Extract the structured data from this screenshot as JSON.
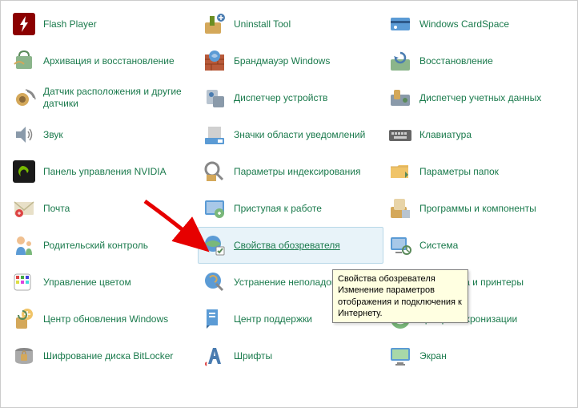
{
  "items": [
    {
      "label": "Flash Player",
      "icon": "flash"
    },
    {
      "label": "Uninstall Tool",
      "icon": "uninstall"
    },
    {
      "label": "Windows CardSpace",
      "icon": "cardspace"
    },
    {
      "label": "Архивация и восстановление",
      "icon": "backup"
    },
    {
      "label": "Брандмауэр Windows",
      "icon": "firewall"
    },
    {
      "label": "Восстановление",
      "icon": "recovery"
    },
    {
      "label": "Датчик расположения и другие датчики",
      "icon": "sensor"
    },
    {
      "label": "Диспетчер устройств",
      "icon": "devmgr"
    },
    {
      "label": "Диспетчер учетных данных",
      "icon": "credmgr"
    },
    {
      "label": "Звук",
      "icon": "sound"
    },
    {
      "label": "Значки области уведомлений",
      "icon": "tray"
    },
    {
      "label": "Клавиатура",
      "icon": "keyboard"
    },
    {
      "label": "Панель управления NVIDIA",
      "icon": "nvidia"
    },
    {
      "label": "Параметры индексирования",
      "icon": "index"
    },
    {
      "label": "Параметры папок",
      "icon": "folder"
    },
    {
      "label": "Почта",
      "icon": "mail"
    },
    {
      "label": "Приступая к работе",
      "icon": "getstarted"
    },
    {
      "label": "Программы и компоненты",
      "icon": "programs"
    },
    {
      "label": "Родительский контроль",
      "icon": "parental"
    },
    {
      "label": "Свойства обозревателя",
      "icon": "inetopt",
      "selected": true
    },
    {
      "label": "Система",
      "icon": "system"
    },
    {
      "label": "Управление цветом",
      "icon": "color"
    },
    {
      "label": "Устранение неполадок",
      "icon": "troubleshoot"
    },
    {
      "label": "Устройства и принтеры",
      "icon": "devices"
    },
    {
      "label": "Центр обновления Windows",
      "icon": "update"
    },
    {
      "label": "Центр поддержки",
      "icon": "action"
    },
    {
      "label": "Центр синхронизации",
      "icon": "sync"
    },
    {
      "label": "Шифрование диска BitLocker",
      "icon": "bitlocker"
    },
    {
      "label": "Шрифты",
      "icon": "fonts"
    },
    {
      "label": "Экран",
      "icon": "display"
    }
  ],
  "tooltip": {
    "title": "Свойства обозревателя",
    "body": "Изменение параметров отображения и подключения к Интернету."
  }
}
